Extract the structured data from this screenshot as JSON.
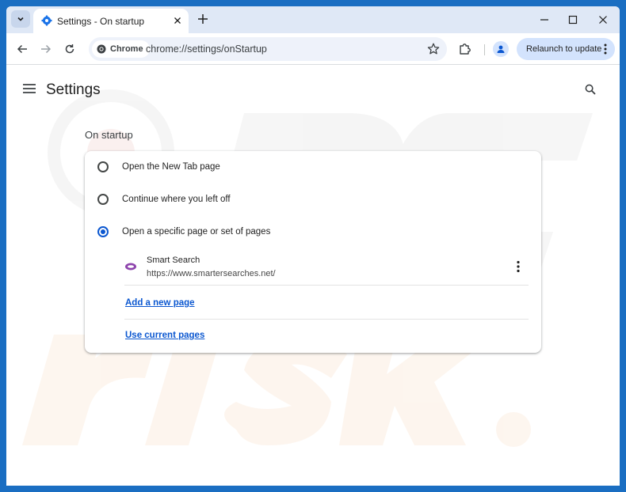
{
  "window": {
    "tab_title": "Settings - On startup",
    "icons": {
      "tab_search": "chevron-down-icon",
      "favicon": "settings-gear-icon",
      "close_tab": "close-icon",
      "new_tab": "plus-icon"
    }
  },
  "toolbar": {
    "chip_label": "Chrome",
    "url": "chrome://settings/onStartup",
    "relaunch_label": "Relaunch to update",
    "icons": {
      "back": "back-arrow-icon",
      "forward": "forward-arrow-icon",
      "reload": "reload-icon",
      "bookmark": "star-icon",
      "extensions": "puzzle-icon",
      "profile": "person-icon",
      "menu": "more-vert-icon"
    }
  },
  "page": {
    "title": "Settings",
    "section_title": "On startup",
    "options": [
      {
        "label": "Open the New Tab page",
        "checked": false
      },
      {
        "label": "Continue where you left off",
        "checked": false
      },
      {
        "label": "Open a specific page or set of pages",
        "checked": true
      }
    ],
    "startup_pages": [
      {
        "name": "Smart Search",
        "url": "https://www.smartersearches.net/"
      }
    ],
    "add_link": "Add a new page",
    "use_current_link": "Use current pages"
  },
  "colors": {
    "accent": "#0b57d0",
    "frame": "#1a6ec2",
    "tabstrip": "#dfe8f6"
  }
}
